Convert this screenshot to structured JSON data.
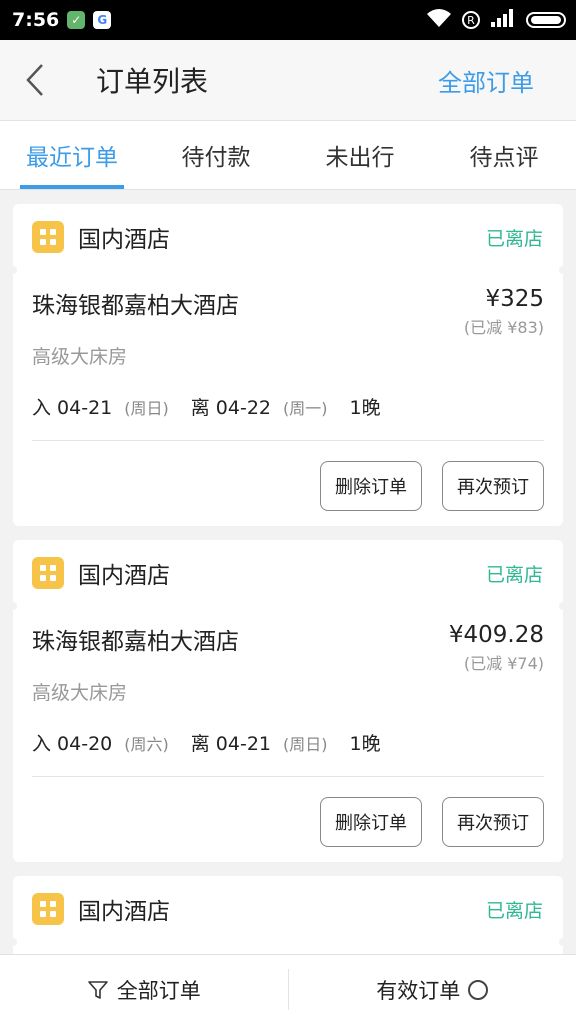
{
  "status_bar": {
    "time": "7:56",
    "r_badge": "R"
  },
  "header": {
    "title": "订单列表",
    "right_link": "全部订单"
  },
  "tabs": [
    {
      "label": "最近订单",
      "active": true
    },
    {
      "label": "待付款",
      "active": false
    },
    {
      "label": "未出行",
      "active": false
    },
    {
      "label": "待点评",
      "active": false
    }
  ],
  "orders": [
    {
      "category": "国内酒店",
      "status": "已离店",
      "hotel": "珠海银都嘉柏大酒店",
      "price": "¥325",
      "saved": "(已减 ¥83)",
      "room": "高级大床房",
      "checkin": "入 04-21",
      "checkin_week": "(周日)",
      "checkout": "离 04-22",
      "checkout_week": "(周一)",
      "nights": "1晚",
      "delete_label": "删除订单",
      "rebook_label": "再次预订"
    },
    {
      "category": "国内酒店",
      "status": "已离店",
      "hotel": "珠海银都嘉柏大酒店",
      "price": "¥409.28",
      "saved": "(已减 ¥74)",
      "room": "高级大床房",
      "checkin": "入 04-20",
      "checkin_week": "(周六)",
      "checkout": "离 04-21",
      "checkout_week": "(周日)",
      "nights": "1晚",
      "delete_label": "删除订单",
      "rebook_label": "再次预订"
    },
    {
      "category": "国内酒店",
      "status": "已离店"
    }
  ],
  "bottom_bar": {
    "filter_label": "全部订单",
    "valid_label": "有效订单"
  },
  "colors": {
    "accent": "#3d9ce8",
    "status_green": "#2fb891",
    "hotel_icon": "#f7c44a"
  }
}
